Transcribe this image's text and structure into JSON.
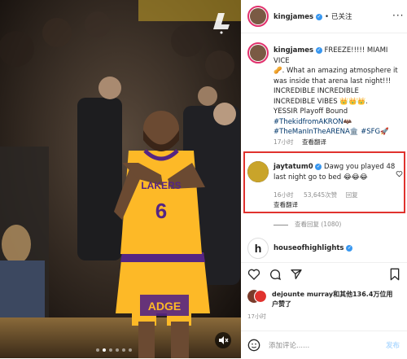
{
  "media": {
    "watermark_icon": "lakers-logo-icon",
    "jersey_text": "LAKERS",
    "jersey_number": "6",
    "sign_text": "ADGE",
    "carousel_dots": 6,
    "active_dot": 1
  },
  "header": {
    "username": "kingjames",
    "separator": "•",
    "follow_status": "已关注"
  },
  "caption": {
    "username": "kingjames",
    "text_1": "FREEZE!!!!! MIAMI VICE",
    "text_2": "🥜. What an amazing atmosphere it",
    "text_3": "was inside that arena last night!!!",
    "text_4": "INCREDIBLE INCREDIBLE",
    "text_5": "INCREDIBLE VIBES 👑👑👑.",
    "text_6": "YESSIR Playoff Bound",
    "tag_1": "#ThekidfromAKRON",
    "tag_1_emoji": "🦇",
    "tag_2": "#TheManInTheARENA",
    "tag_2_emoji": "🏛️",
    "tag_3": "#SFG",
    "tag_3_emoji": "🚀",
    "time": "17小时",
    "see_translation": "查看翻译"
  },
  "comment": {
    "username": "jaytatum0",
    "text_1": "Dawg you played 48",
    "text_2": "last night go to bed 😂😂😂",
    "time": "16小时",
    "likes": "53,645次赞",
    "reply": "回复",
    "see_translation": "查看翻译",
    "view_replies": "查看回复 (1080)"
  },
  "next_comment": {
    "username": "houseofhighlights"
  },
  "likes": {
    "text_1": "dejounte murray和其他136.4万位用",
    "text_2": "户赞了"
  },
  "post_time": "17小时",
  "add_comment": {
    "placeholder": "添加评论......",
    "post_label": "发布"
  }
}
